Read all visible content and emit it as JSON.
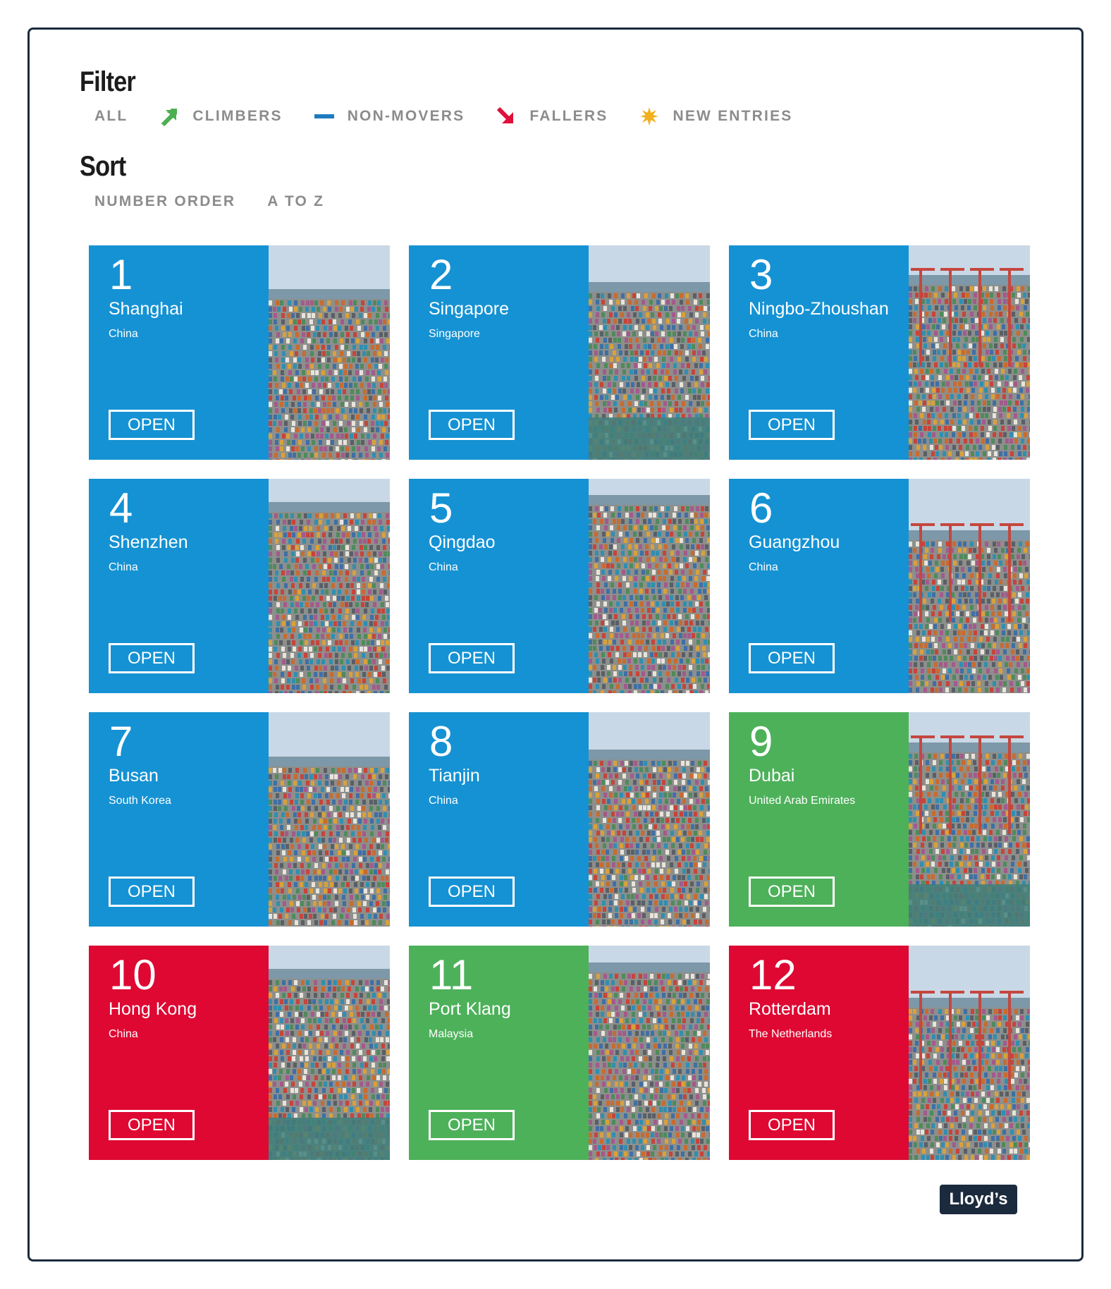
{
  "filter": {
    "title": "Filter",
    "options": [
      {
        "label": "ALL",
        "icon": "none"
      },
      {
        "label": "CLIMBERS",
        "icon": "arrow-up-right-icon",
        "color": "#4caf50"
      },
      {
        "label": "NON-MOVERS",
        "icon": "dash-icon",
        "color": "#1e7bbf"
      },
      {
        "label": "FALLERS",
        "icon": "arrow-down-right-icon",
        "color": "#e0103a"
      },
      {
        "label": "NEW ENTRIES",
        "icon": "star-burst-icon",
        "color": "#f2b01e"
      }
    ]
  },
  "sort": {
    "title": "Sort",
    "options": [
      {
        "label": "NUMBER ORDER"
      },
      {
        "label": "A TO Z"
      }
    ]
  },
  "colors": {
    "non_mover": "#1592d3",
    "climber": "#4db15a",
    "faller": "#de0832",
    "frame": "#1b2a3d"
  },
  "ports": [
    {
      "rank": "1",
      "city": "Shanghai",
      "country": "China",
      "status": "non-mover",
      "button": "OPEN"
    },
    {
      "rank": "2",
      "city": "Singapore",
      "country": "Singapore",
      "status": "non-mover",
      "button": "OPEN"
    },
    {
      "rank": "3",
      "city": "Ningbo-Zhoushan",
      "country": "China",
      "status": "non-mover",
      "button": "OPEN"
    },
    {
      "rank": "4",
      "city": "Shenzhen",
      "country": "China",
      "status": "non-mover",
      "button": "OPEN"
    },
    {
      "rank": "5",
      "city": "Qingdao",
      "country": "China",
      "status": "non-mover",
      "button": "OPEN"
    },
    {
      "rank": "6",
      "city": "Guangzhou",
      "country": "China",
      "status": "non-mover",
      "button": "OPEN"
    },
    {
      "rank": "7",
      "city": "Busan",
      "country": "South Korea",
      "status": "non-mover",
      "button": "OPEN"
    },
    {
      "rank": "8",
      "city": "Tianjin",
      "country": "China",
      "status": "non-mover",
      "button": "OPEN"
    },
    {
      "rank": "9",
      "city": "Dubai",
      "country": "United Arab Emirates",
      "status": "climber",
      "button": "OPEN"
    },
    {
      "rank": "10",
      "city": "Hong Kong",
      "country": "China",
      "status": "faller",
      "button": "OPEN"
    },
    {
      "rank": "11",
      "city": "Port Klang",
      "country": "Malaysia",
      "status": "climber",
      "button": "OPEN"
    },
    {
      "rank": "12",
      "city": "Rotterdam",
      "country": "The Netherlands",
      "status": "faller",
      "button": "OPEN"
    }
  ],
  "brand": {
    "logo_text": "Lloyd’s"
  }
}
